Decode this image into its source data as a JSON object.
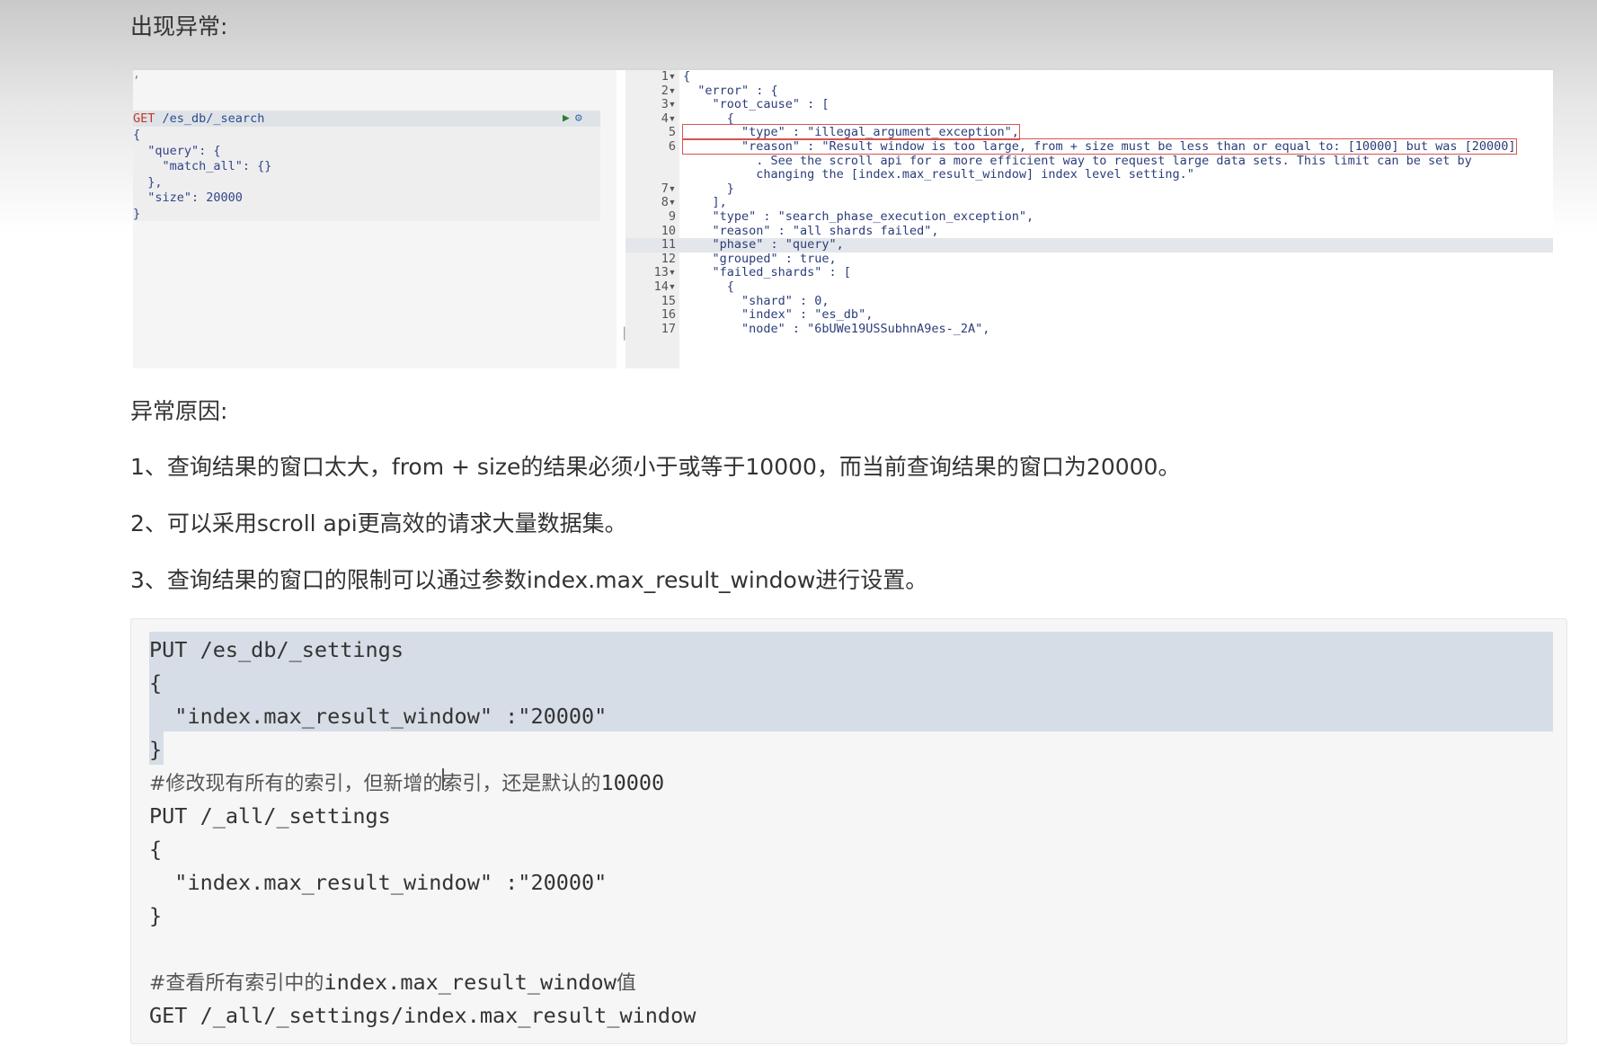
{
  "heading1": "出现异常:",
  "kibana": {
    "request": {
      "method": "GET",
      "path": "/es_db/_search",
      "lines": [
        "{",
        "  \"query\": {",
        "    \"match_all\": {}",
        "  },",
        "  \"size\": 20000",
        "}"
      ],
      "run_icon": "play-icon",
      "settings_icon": "wrench-icon"
    },
    "response_lines": [
      {
        "n": "1",
        "fold": "▾",
        "text": "{"
      },
      {
        "n": "2",
        "fold": "▾",
        "text": "  \"error\" : {"
      },
      {
        "n": "3",
        "fold": "▾",
        "text": "    \"root_cause\" : ["
      },
      {
        "n": "4",
        "fold": "▾",
        "text": "      {"
      },
      {
        "n": "5",
        "fold": "",
        "text": "        \"type\" : \"illegal_argument_exception\","
      },
      {
        "n": "6",
        "fold": "",
        "text": "        \"reason\" : \"Result window is too large, from + size must be less than or equal to: [10000] but was [20000]"
      },
      {
        "n": "",
        "fold": "",
        "text": "          . See the scroll api for a more efficient way to request large data sets. This limit can be set by"
      },
      {
        "n": "",
        "fold": "",
        "text": "          changing the [index.max_result_window] index level setting.\""
      },
      {
        "n": "7",
        "fold": "▾",
        "text": "      }"
      },
      {
        "n": "8",
        "fold": "▾",
        "text": "    ],"
      },
      {
        "n": "9",
        "fold": "",
        "text": "    \"type\" : \"search_phase_execution_exception\","
      },
      {
        "n": "10",
        "fold": "",
        "text": "    \"reason\" : \"all shards failed\","
      },
      {
        "n": "11",
        "fold": "",
        "text": "    \"phase\" : \"query\","
      },
      {
        "n": "12",
        "fold": "",
        "text": "    \"grouped\" : true,"
      },
      {
        "n": "13",
        "fold": "▾",
        "text": "    \"failed_shards\" : ["
      },
      {
        "n": "14",
        "fold": "▾",
        "text": "      {"
      },
      {
        "n": "15",
        "fold": "",
        "text": "        \"shard\" : 0,"
      },
      {
        "n": "16",
        "fold": "",
        "text": "        \"index\" : \"es_db\","
      },
      {
        "n": "17",
        "fold": "",
        "text": "        \"node\" : \"6bUWe19USSubhnA9es-_2A\","
      }
    ]
  },
  "heading2": "异常原因:",
  "reasons": [
    "1、查询结果的窗口太大，from + size的结果必须小于或等于10000，而当前查询结果的窗口为20000。",
    "2、可以采用scroll api更高效的请求大量数据集。",
    "3、查询结果的窗口的限制可以通过参数index.max_result_window进行设置。"
  ],
  "code": {
    "line1": "PUT /es_db/_settings",
    "line2": "{",
    "line3": "  \"index.max_result_window\" :\"20000\"",
    "line4": "}",
    "comment1_cn": "#修改现有所有的索引，但新增的索引，还是默认的",
    "comment1_num": "10000",
    "line6": "PUT /_all/_settings",
    "line7": "{",
    "line8": "  \"index.max_result_window\" :\"20000\"",
    "line9": "}",
    "comment2_prefix": "#查看所有索引中的",
    "comment2_code": "index.max_result_window",
    "comment2_suffix": "值",
    "line12": "GET /_all/_settings/index.max_result_window"
  }
}
